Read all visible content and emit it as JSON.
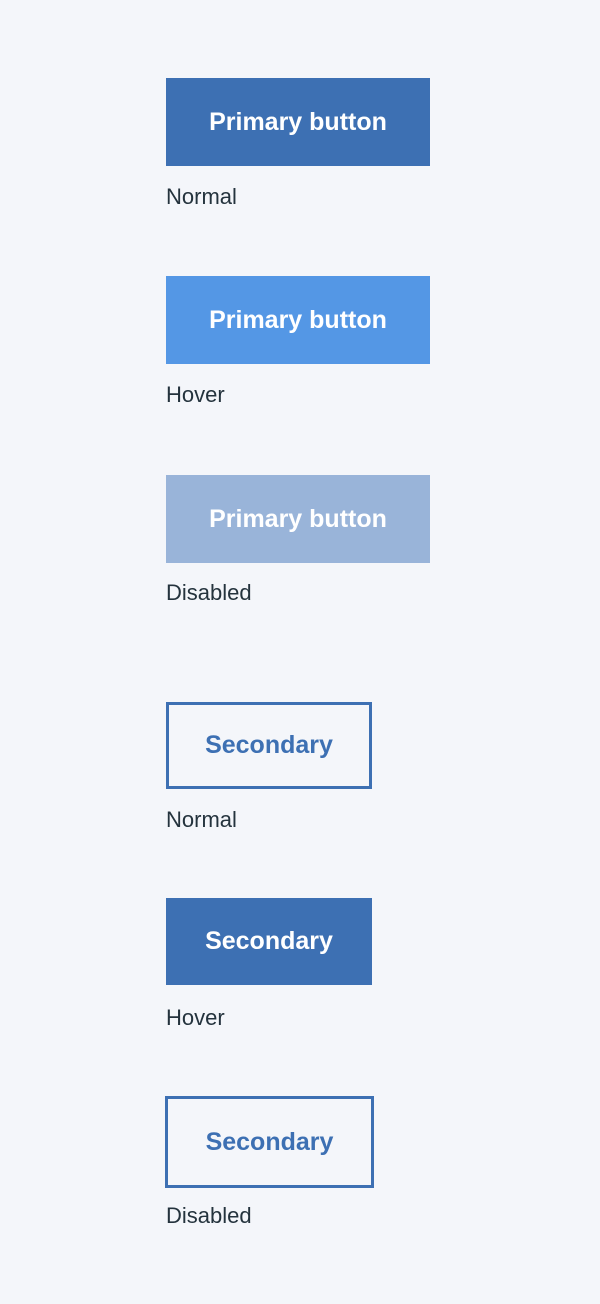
{
  "colors": {
    "page_background": "#f4f6fa",
    "primary_normal": "#3d70b3",
    "primary_hover": "#5497e5",
    "primary_disabled": "#99b4d9",
    "secondary_accent": "#3d70b3",
    "caption_text": "#24333d"
  },
  "primary_buttons": [
    {
      "label": "Primary button",
      "state": "Normal"
    },
    {
      "label": "Primary button",
      "state": "Hover"
    },
    {
      "label": "Primary button",
      "state": "Disabled"
    }
  ],
  "secondary_buttons": [
    {
      "label": "Secondary",
      "state": "Normal"
    },
    {
      "label": "Secondary",
      "state": "Hover"
    },
    {
      "label": "Secondary",
      "state": "Disabled"
    }
  ]
}
